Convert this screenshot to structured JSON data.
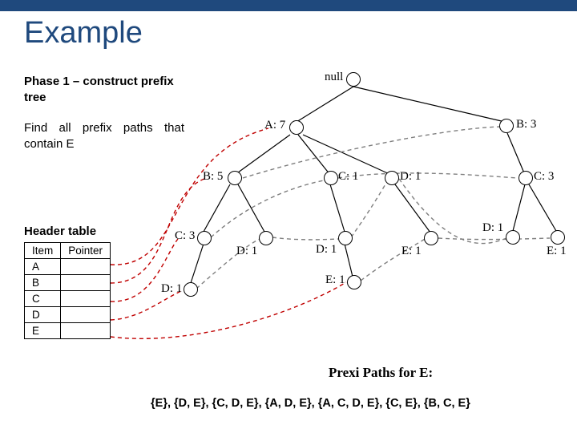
{
  "title": "Example",
  "phase": "Phase 1 – construct prefix tree",
  "instruction": "Find all prefix paths that contain E",
  "header_table": {
    "title": "Header table",
    "cols": [
      "Item",
      "Pointer"
    ],
    "items": [
      "A",
      "B",
      "C",
      "D",
      "E"
    ]
  },
  "tree": {
    "root": "null",
    "nodes": {
      "A7": "A: 7",
      "B3": "B: 3",
      "B5": "B: 5",
      "C1": "C: 1",
      "D1a": "D: 1",
      "C3b": "C: 3",
      "D1b": "D: 1",
      "D1c": "D: 1",
      "D1d": "D: 1",
      "E1a": "E: 1",
      "E1b": "E: 1",
      "C3r": "C: 3",
      "D1r": "D: 1",
      "E1r": "E: 1"
    }
  },
  "prefix_paths": {
    "title": "Prexi Paths for E:",
    "line": "{E}, {D, E}, {C, D, E}, {A, D, E}, {A, C, D, E}, {C, E}, {B, C, E}"
  }
}
